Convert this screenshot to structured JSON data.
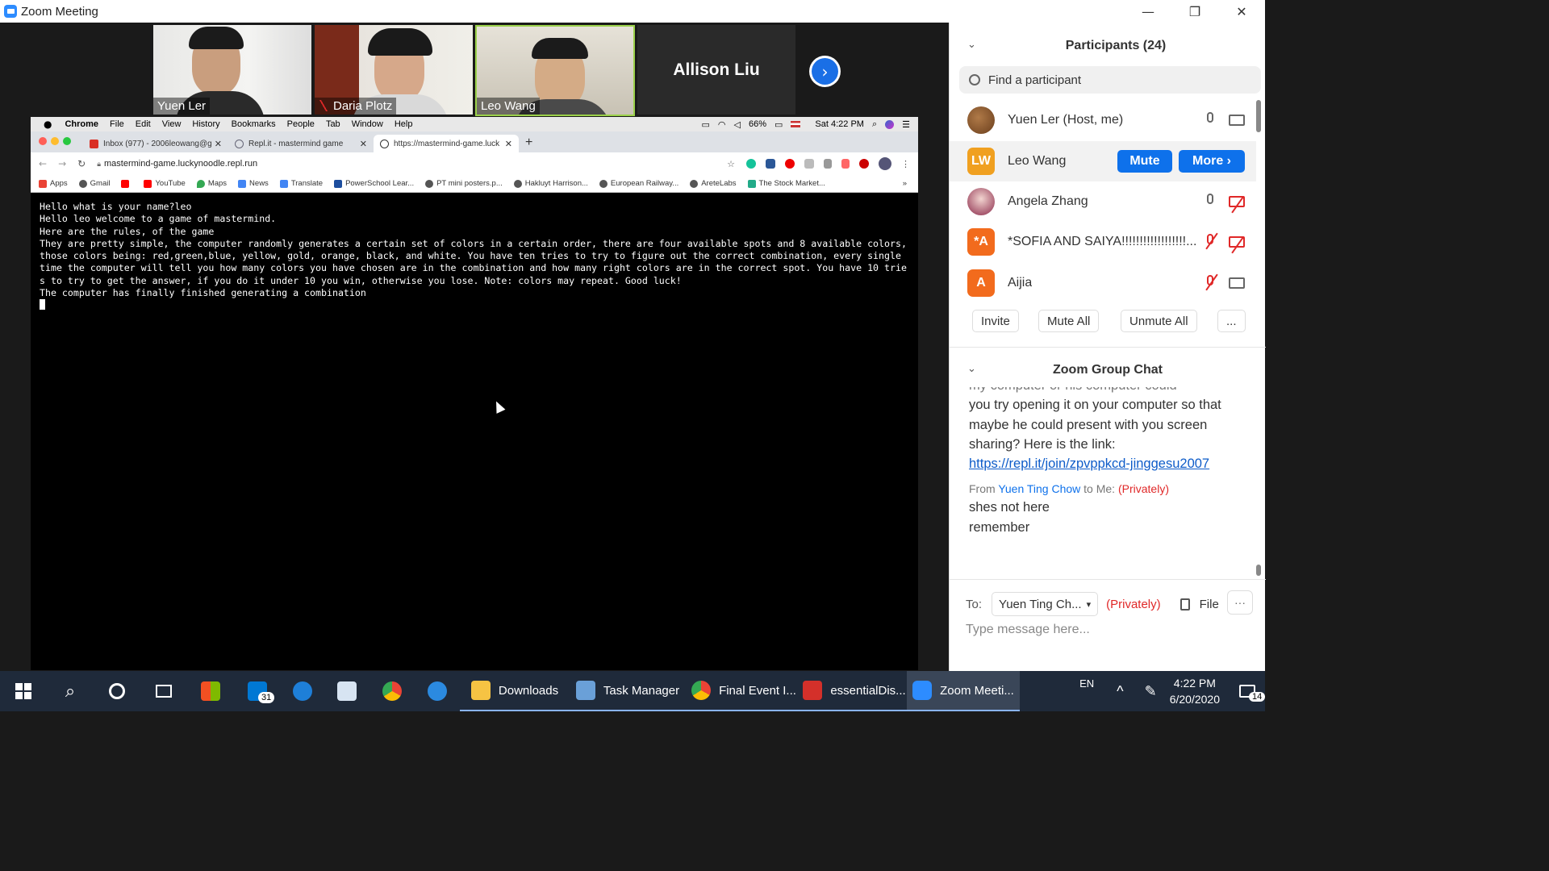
{
  "window": {
    "title": "Zoom Meeting"
  },
  "videos": [
    {
      "name": "Yuen Ler",
      "muted": false
    },
    {
      "name": "Daria Plotz",
      "muted": true
    },
    {
      "name": "Leo Wang",
      "muted": true
    }
  ],
  "speaker": {
    "name": "Allison Liu"
  },
  "mac_menu": {
    "items": [
      "Chrome",
      "File",
      "Edit",
      "View",
      "History",
      "Bookmarks",
      "People",
      "Tab",
      "Window",
      "Help"
    ],
    "battery": "66%",
    "time": "Sat 4:22 PM"
  },
  "chrome": {
    "tabs": [
      {
        "label": "Inbox (977) - 2006leowang@g",
        "color": "#d93025"
      },
      {
        "label": "Repl.it - mastermind game",
        "color": "#667"
      },
      {
        "label": "https://mastermind-game.luck",
        "color": "#333"
      }
    ],
    "url": "mastermind-game.luckynoodle.repl.run",
    "bookmarks": [
      "Apps",
      "Gmail",
      "",
      "YouTube",
      "Maps",
      "News",
      "Translate",
      "PowerSchool Lear...",
      "PT mini posters.p...",
      "Hakluyt Harrison...",
      "European Railway...",
      "AreteLabs",
      "The Stock Market..."
    ],
    "more": "»"
  },
  "console": {
    "text": "Hello what is your name?leo\nHello leo welcome to a game of mastermind.\nHere are the rules, of the game\nThey are pretty simple, the computer randomly generates a certain set of colors in a certain order, there are four available spots and 8 available colors, those colors being: red,green,blue, yellow, gold, orange, black, and white. You have ten tries to try to figure out the correct combination, every single time the computer will tell you how many colors you have chosen are in the combination and how many right colors are in the correct spot. You have 10 tries to try to get the answer, if you do it under 10 you win, otherwise you lose. Note: colors may repeat. Good luck!\nThe computer has finally finished generating a combination"
  },
  "participants": {
    "title": "Participants (24)",
    "search_placeholder": "Find a participant",
    "list": [
      {
        "name": "Yuen Ler (Host, me)",
        "initials": "",
        "color": "#8a5a2b",
        "mic_muted": false,
        "cam_off": false
      },
      {
        "name": "Leo Wang",
        "initials": "LW",
        "color": "#f0a020",
        "mic_muted": false,
        "cam_off": false
      },
      {
        "name": "Angela Zhang",
        "initials": "",
        "color": "#b07090",
        "mic_muted": false,
        "cam_off": true
      },
      {
        "name": "*SOFIA AND SAIYA!!!!!!!!!!!!!!!!!!...",
        "initials": "*A",
        "color": "#f26b1d",
        "mic_muted": true,
        "cam_off": true
      },
      {
        "name": "Aijia",
        "initials": "A",
        "color": "#f26b1d",
        "mic_muted": true,
        "cam_off": false
      }
    ],
    "mute_label": "Mute",
    "more_label": "More ›",
    "actions": [
      "Invite",
      "Mute All",
      "Unmute All",
      "..."
    ]
  },
  "chat": {
    "title": "Zoom Group Chat",
    "partial_line": "my computer or his computer could",
    "message1": "you try opening it on your computer so that maybe he could present with you screen sharing? Here is the link:",
    "link": "https://repl.it/join/zpvppkcd-jinggesu2007",
    "from_label": "From",
    "from_name": "Yuen Ting Chow",
    "to_label": "to Me:",
    "privately": "(Privately)",
    "message2_line1": "shes not here",
    "message2_line2": "remember",
    "to": "To:",
    "recipient": "Yuen Ting Ch...",
    "file": "File",
    "more": "···",
    "input_placeholder": "Type message here..."
  },
  "taskbar": {
    "mail_badge": "31",
    "apps": [
      {
        "label": "Downloads",
        "color": "#f6c343"
      },
      {
        "label": "Task Manager",
        "color": "#6aa0d8"
      },
      {
        "label": "Final Event I...",
        "color": "#e04a3a"
      },
      {
        "label": "essentialDis...",
        "color": "#d4302a"
      },
      {
        "label": "Zoom Meeti...",
        "color": "#2d8cff"
      }
    ],
    "lang": "EN",
    "time": "4:22 PM",
    "date": "6/20/2020",
    "notifications": "14"
  },
  "colors": {
    "zoom_blue": "#0e71eb",
    "danger": "#e02828",
    "taskbar": "#1f2a3a"
  }
}
